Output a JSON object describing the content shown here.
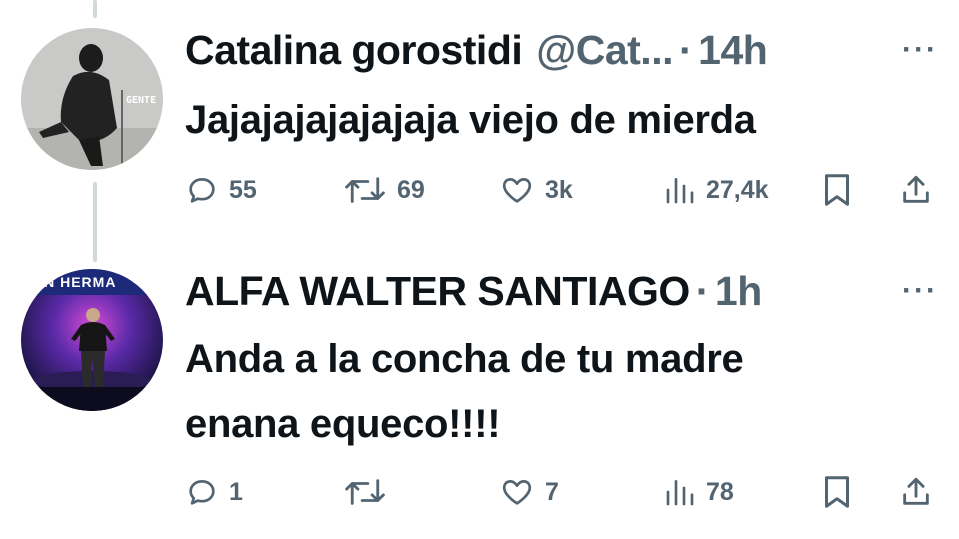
{
  "tweets": [
    {
      "name": "Catalina gorostidi",
      "handle": "@Cat...",
      "separator": "·",
      "time": "14h",
      "more": "···",
      "text": "Jajajajajajajaja viejo de mierda",
      "avatar_badge": "GENTE",
      "actions": {
        "reply": "55",
        "retweet": "69",
        "like": "3k",
        "views": "27,4k"
      }
    },
    {
      "name": "ALFA WALTER SANTIAGO",
      "separator": "·",
      "time": "1h",
      "more": "···",
      "text_line1": "Anda a la concha de tu madre",
      "text_line2": "enana equeco!!!!",
      "avatar_banner": "AN HERMA",
      "actions": {
        "reply": "1",
        "retweet": "",
        "like": "7",
        "views": "78"
      }
    }
  ],
  "colors": {
    "text": "#0f1419",
    "secondary": "#536471",
    "thread_line": "#cfd9de"
  }
}
